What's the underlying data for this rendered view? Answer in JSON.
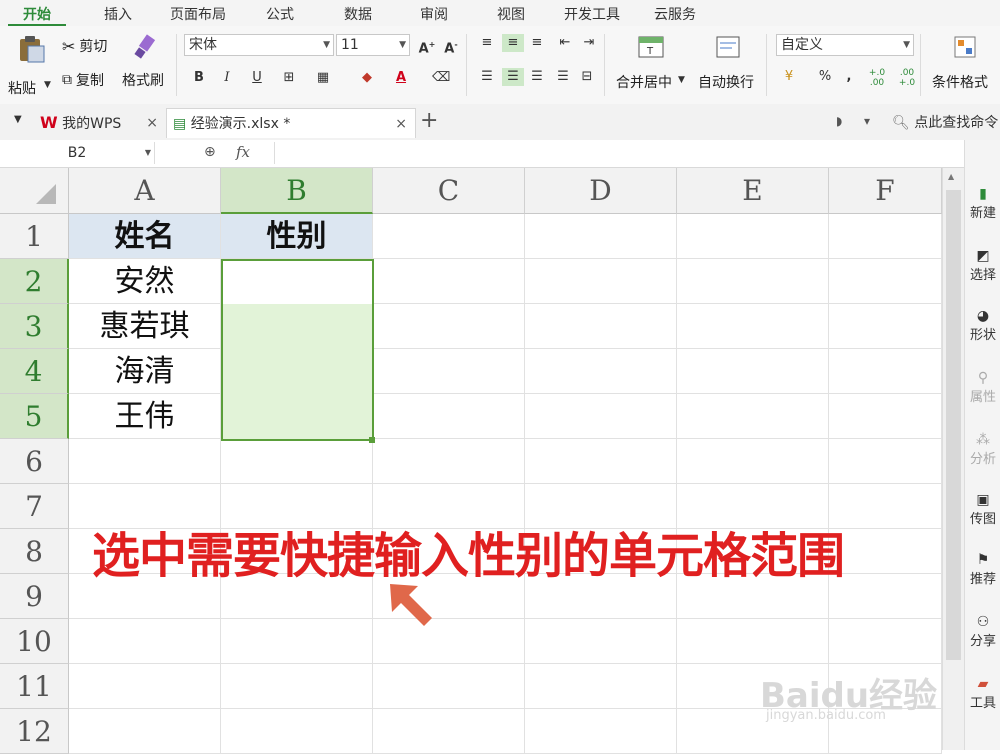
{
  "menu": {
    "tabs": [
      "开始",
      "插入",
      "页面布局",
      "公式",
      "数据",
      "审阅",
      "视图",
      "开发工具",
      "云服务"
    ],
    "active_index": 0
  },
  "ribbon": {
    "paste": "粘贴",
    "cut": "剪切",
    "copy": "复制",
    "format_painter": "格式刷",
    "font_name": "宋体",
    "font_size": "11",
    "bold": "B",
    "italic": "I",
    "underline": "U",
    "merge_center": "合并居中",
    "auto_wrap": "自动换行",
    "number_format": "自定义",
    "percent": "%",
    "comma": ",",
    "dec_inc": "+.0 .00",
    "dec_dec": ".00 +.0",
    "conditional_format": "条件格式"
  },
  "doctabs": {
    "wps_home": "我的WPS",
    "file": "经验演示.xlsx *",
    "search_hint": "点此查找命令"
  },
  "formula_bar": {
    "name_box": "B2",
    "fx": "fx",
    "content": ""
  },
  "grid": {
    "columns": [
      "A",
      "B",
      "C",
      "D",
      "E",
      "F"
    ],
    "rows": [
      "1",
      "2",
      "3",
      "4",
      "5",
      "6",
      "7",
      "8",
      "9",
      "10",
      "11",
      "12"
    ],
    "cells": {
      "A1": "姓名",
      "B1": "性别",
      "A2": "安然",
      "A3": "惠若琪",
      "A4": "海清",
      "A5": "王伟"
    }
  },
  "annotation": {
    "text": "选中需要快捷输入性别的单元格范围",
    "color": "#e02020",
    "arrow_color": "#e0684a"
  },
  "sidebar": {
    "items": [
      "新建",
      "选择",
      "形状",
      "属性",
      "分析",
      "传图",
      "推荐",
      "分享",
      "工具"
    ]
  },
  "watermark": {
    "brand": "Baidu经验",
    "url": "jingyan.baidu.com"
  },
  "colors": {
    "accent": "#2e8b3a",
    "selection_fill": "#e2f3d8",
    "selection_border": "#5a9e3a",
    "header_fill": "#dce6f1"
  }
}
